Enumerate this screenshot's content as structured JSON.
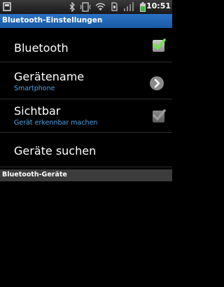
{
  "status_bar": {
    "time": "10:51",
    "icons": [
      "notification-icon",
      "bluetooth-icon",
      "vibrate-icon",
      "wifi-icon",
      "sim-icon",
      "signal-icon",
      "battery-icon"
    ]
  },
  "title": "Bluetooth-Einstellungen",
  "items": [
    {
      "label": "Bluetooth",
      "checked": true
    },
    {
      "label": "Gerätename",
      "summary": "Smartphone"
    },
    {
      "label": "Sichtbar",
      "summary": "Gerät erkennbar machen",
      "checked": true,
      "enabled": false
    },
    {
      "label": "Geräte suchen"
    }
  ],
  "section_header": "Bluetooth-Geräte",
  "colors": {
    "title_bar": "#1f64b0",
    "summary_text": "#4da3e6",
    "check_active": "#6ee84a",
    "check_disabled": "#9a9a9a",
    "section_bg": "#3c3c3c"
  }
}
